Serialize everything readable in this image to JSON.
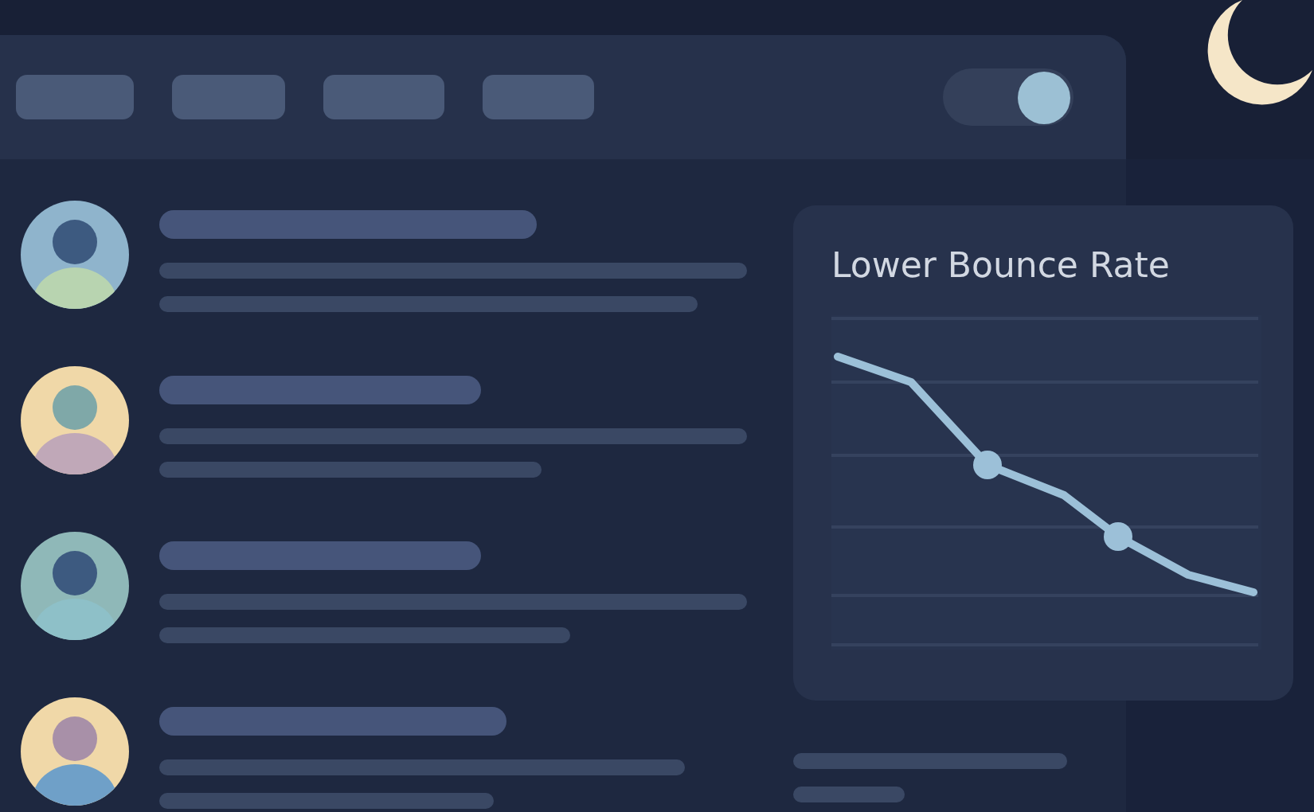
{
  "top_bar": {
    "toggle": {
      "on": true
    }
  },
  "list": [
    {
      "avatar": {
        "color": "#8fb4cc"
      }
    },
    {
      "avatar": {
        "color": "#f0d8a8"
      }
    },
    {
      "avatar": {
        "color": "#8fb8b8"
      }
    },
    {
      "avatar": {
        "color": "#f0d8a8"
      }
    }
  ],
  "card": {
    "title": "Lower Bounce Rate"
  }
}
